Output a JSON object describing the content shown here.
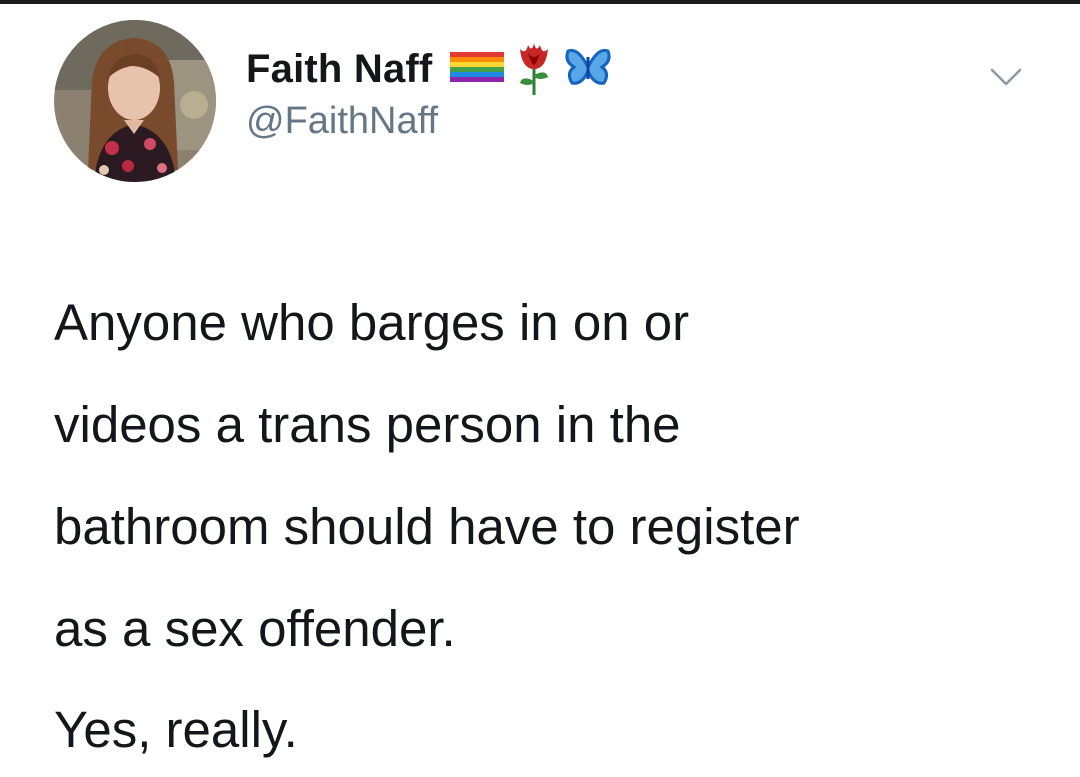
{
  "author": {
    "display_name": "Faith Naff",
    "handle": "@FaithNaff",
    "badges": [
      "rainbow-flag-emoji",
      "rose-emoji",
      "blue-butterfly-emoji"
    ]
  },
  "tweet": {
    "lines": [
      "Anyone who barges in on or",
      "videos a trans person in the",
      "bathroom should have to register",
      "as a sex offender."
    ],
    "closing": "Yes, really."
  },
  "colors": {
    "text": "#14171a",
    "secondary": "#657786",
    "background": "#ffffff"
  }
}
